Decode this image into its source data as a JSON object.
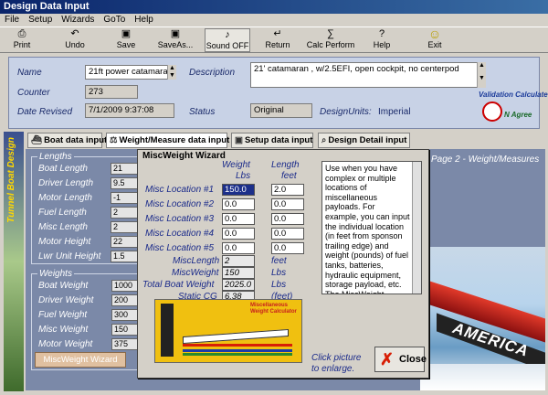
{
  "window": {
    "title": "Design Data Input"
  },
  "menu": [
    "File",
    "Setup",
    "Wizards",
    "GoTo",
    "Help"
  ],
  "toolbar": [
    {
      "label": "Print",
      "icon": "printer-icon",
      "glyph": "⎙"
    },
    {
      "label": "Undo",
      "icon": "undo-icon",
      "glyph": "↶"
    },
    {
      "label": "Save",
      "icon": "save-icon",
      "glyph": "▣"
    },
    {
      "label": "SaveAs...",
      "icon": "save-as-icon",
      "glyph": "▣"
    },
    {
      "label": "Sound OFF",
      "icon": "sound-icon",
      "glyph": "♪"
    },
    {
      "label": "Return",
      "icon": "return-icon",
      "glyph": "↵"
    },
    {
      "label": "Calc Perform",
      "icon": "calculator-icon",
      "glyph": "∑"
    },
    {
      "label": "Help",
      "icon": "help-icon",
      "glyph": "?"
    },
    {
      "label": "Exit",
      "icon": "exit-smiley-icon",
      "glyph": "☺"
    }
  ],
  "header": {
    "name_label": "Name",
    "name": "21ft power catamaran",
    "description_label": "Description",
    "description": "21' catamaran , w/2.5EFI, open cockpit, no centerpod",
    "counter_label": "Counter",
    "counter": "273",
    "date_label": "Date Revised",
    "date": "7/1/2009 9:37:08",
    "status_label": "Status",
    "status": "Original",
    "units_label": "DesignUnits:",
    "units": "Imperial",
    "logo_text_1": "Validation Calculate",
    "logo_text_2": "N Agree"
  },
  "sidebar_title": "Tunnel Boat Design",
  "tabs": [
    "Boat data input",
    "Weight/Measure data input",
    "Setup data input",
    "Design Detail input"
  ],
  "lengths": {
    "legend": "Lengths",
    "rows": [
      {
        "label": "Boat Length",
        "value": "21"
      },
      {
        "label": "Driver Length",
        "value": "9.5"
      },
      {
        "label": "Motor Length",
        "value": "-1"
      },
      {
        "label": "Fuel Length",
        "value": "2"
      },
      {
        "label": "Misc Length",
        "value": "2"
      },
      {
        "label": "Motor Height",
        "value": "22"
      },
      {
        "label": "Lwr Unit Height",
        "value": "1.5"
      }
    ]
  },
  "weights": {
    "legend": "Weights",
    "rows": [
      {
        "label": "Boat Weight",
        "value": "1000"
      },
      {
        "label": "Driver Weight",
        "value": "200"
      },
      {
        "label": "Fuel Weight",
        "value": "300"
      },
      {
        "label": "Misc Weight",
        "value": "150"
      },
      {
        "label": "Motor Weight",
        "value": "375"
      }
    ],
    "wizard_button": "MiscWeight Wizard"
  },
  "page_title": "Page 2 - Weight/Measures",
  "dialog": {
    "title": "MiscWeight Wizard",
    "col_weight": "Weight",
    "col_weight_unit": "Lbs",
    "col_length": "Length",
    "col_length_unit": "feet",
    "locations": [
      {
        "label": "Misc Location #1",
        "weight": "150.0",
        "length": "2.0"
      },
      {
        "label": "Misc Location #2",
        "weight": "0.0",
        "length": "0.0"
      },
      {
        "label": "Misc Location #3",
        "weight": "0.0",
        "length": "0.0"
      },
      {
        "label": "Misc Location #4",
        "weight": "0.0",
        "length": "0.0"
      },
      {
        "label": "Misc Location #5",
        "weight": "0.0",
        "length": "0.0"
      }
    ],
    "summary": [
      {
        "label": "MiscLength",
        "value": "2",
        "unit": "feet"
      },
      {
        "label": "MiscWeight",
        "value": "150",
        "unit": "Lbs"
      },
      {
        "label": "Total Boat Weight",
        "value": "2025.0",
        "unit": "Lbs"
      },
      {
        "label": "Static CG",
        "value": "6.38",
        "unit": "(feet)"
      }
    ],
    "help_text": "Use when you have complex or multiple locations of miscellaneous payloads. For example, you can input the individual location (in feet from sponson trailing edge) and weight (pounds) of fuel tanks, batteries, hydraulic equipment, storage payload, etc. The MiscWeight Calculator will determine the combined 'moment' of these weights",
    "diagram_caption": "Miscellaneous Weight Calculator",
    "hint": "Click picture to enlarge.",
    "close_button": "Close"
  },
  "photo_text": "AMERICA"
}
